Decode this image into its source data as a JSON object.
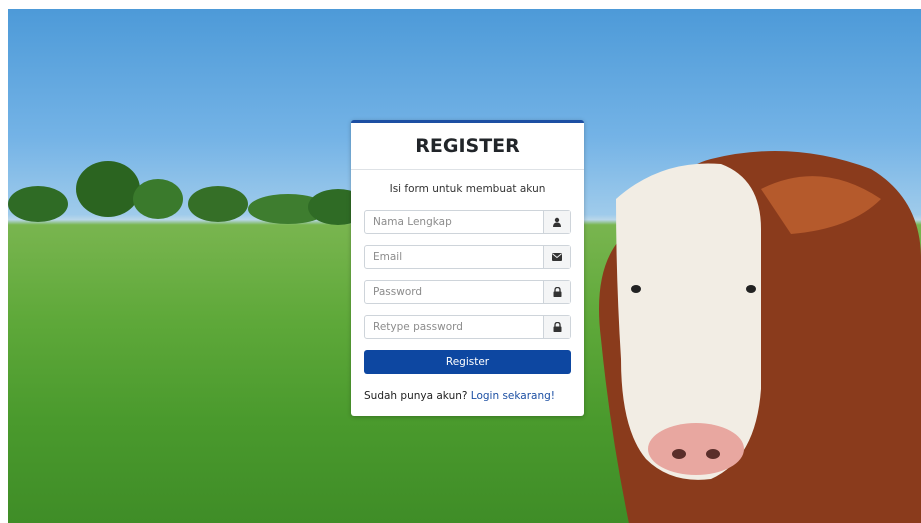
{
  "form": {
    "title": "REGISTER",
    "subtitle": "Isi form untuk membuat akun",
    "fields": [
      {
        "placeholder": "Nama Lengkap",
        "icon": "user-icon"
      },
      {
        "placeholder": "Email",
        "icon": "envelope-icon"
      },
      {
        "placeholder": "Password",
        "icon": "lock-icon"
      },
      {
        "placeholder": "Retype password",
        "icon": "lock-icon"
      }
    ],
    "submit_label": "Register",
    "footer_text": "Sudah punya akun?",
    "login_link": "Login sekarang!"
  },
  "colors": {
    "accent": "#0d47a1",
    "card_border": "#1c4fa3",
    "sky": "#74b3e6",
    "grass": "#5fa93a"
  }
}
